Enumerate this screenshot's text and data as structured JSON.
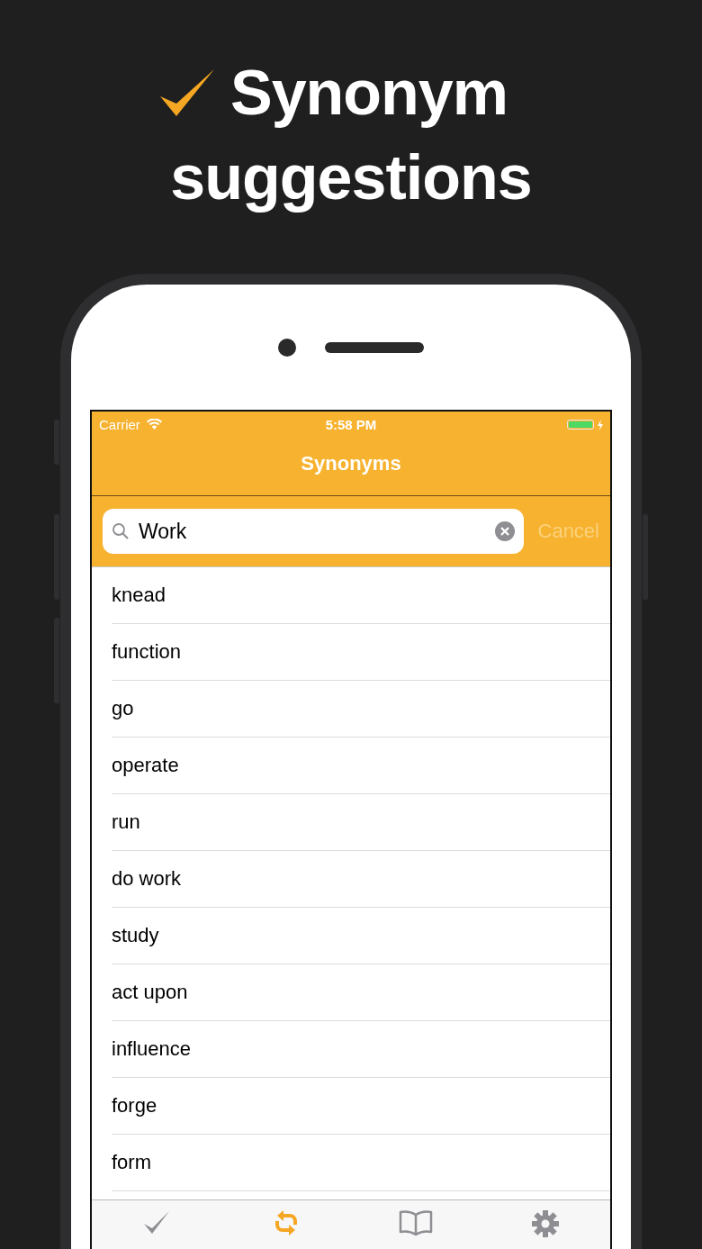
{
  "headline_lines": [
    "Synonym",
    "suggestions"
  ],
  "status_bar": {
    "carrier": "Carrier",
    "time": "5:58 PM",
    "battery": {
      "level": 1,
      "charging": true
    }
  },
  "nav_bar": {
    "title": "Synonyms"
  },
  "search": {
    "value": "Work",
    "cancel": {
      "label": "Cancel",
      "disabled": true
    }
  },
  "results": [
    "knead",
    "function",
    "go",
    "operate",
    "run",
    "do work",
    "study",
    "act upon",
    "influence",
    "forge",
    "form"
  ],
  "tabs": [
    {
      "kind": "check",
      "selected": false
    },
    {
      "kind": "swap",
      "selected": true
    },
    {
      "kind": "book",
      "selected": false
    },
    {
      "kind": "gear",
      "selected": false
    }
  ]
}
